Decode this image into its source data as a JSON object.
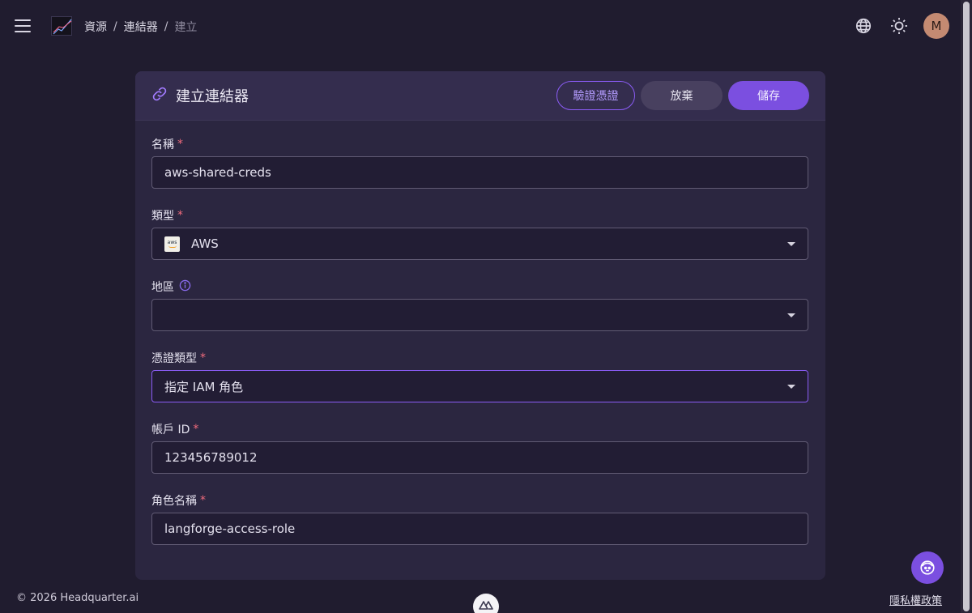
{
  "header": {
    "breadcrumb": [
      "資源",
      "連結器",
      "建立"
    ],
    "breadcrumb_sep": "/",
    "avatar_initial": "M",
    "icons": [
      "menu-icon",
      "globe-icon",
      "sun-icon"
    ]
  },
  "card": {
    "title": "建立連結器",
    "title_icon": "link-icon",
    "verify_label": "驗證憑證",
    "discard_label": "放棄",
    "save_label": "儲存"
  },
  "form": {
    "name": {
      "label": "名稱",
      "required": "*",
      "value": "aws-shared-creds"
    },
    "type": {
      "label": "類型",
      "required": "*",
      "value": "AWS",
      "badge_text": "aws"
    },
    "region": {
      "label": "地區",
      "value": ""
    },
    "credential_type": {
      "label": "憑證類型",
      "required": "*",
      "value": "指定 IAM 角色"
    },
    "account_id": {
      "label": "帳戶 ID",
      "required": "*",
      "value": "123456789012"
    },
    "role_name": {
      "label": "角色名稱",
      "required": "*",
      "value": "langforge-access-role"
    }
  },
  "footer": {
    "copyright": "© 2026 Headquarter.ai",
    "privacy_link": "隱私權政策"
  },
  "colors": {
    "background": "#201c2f",
    "card": "#2b2640",
    "accent": "#7b4fe0",
    "required": "#f06b7c"
  }
}
